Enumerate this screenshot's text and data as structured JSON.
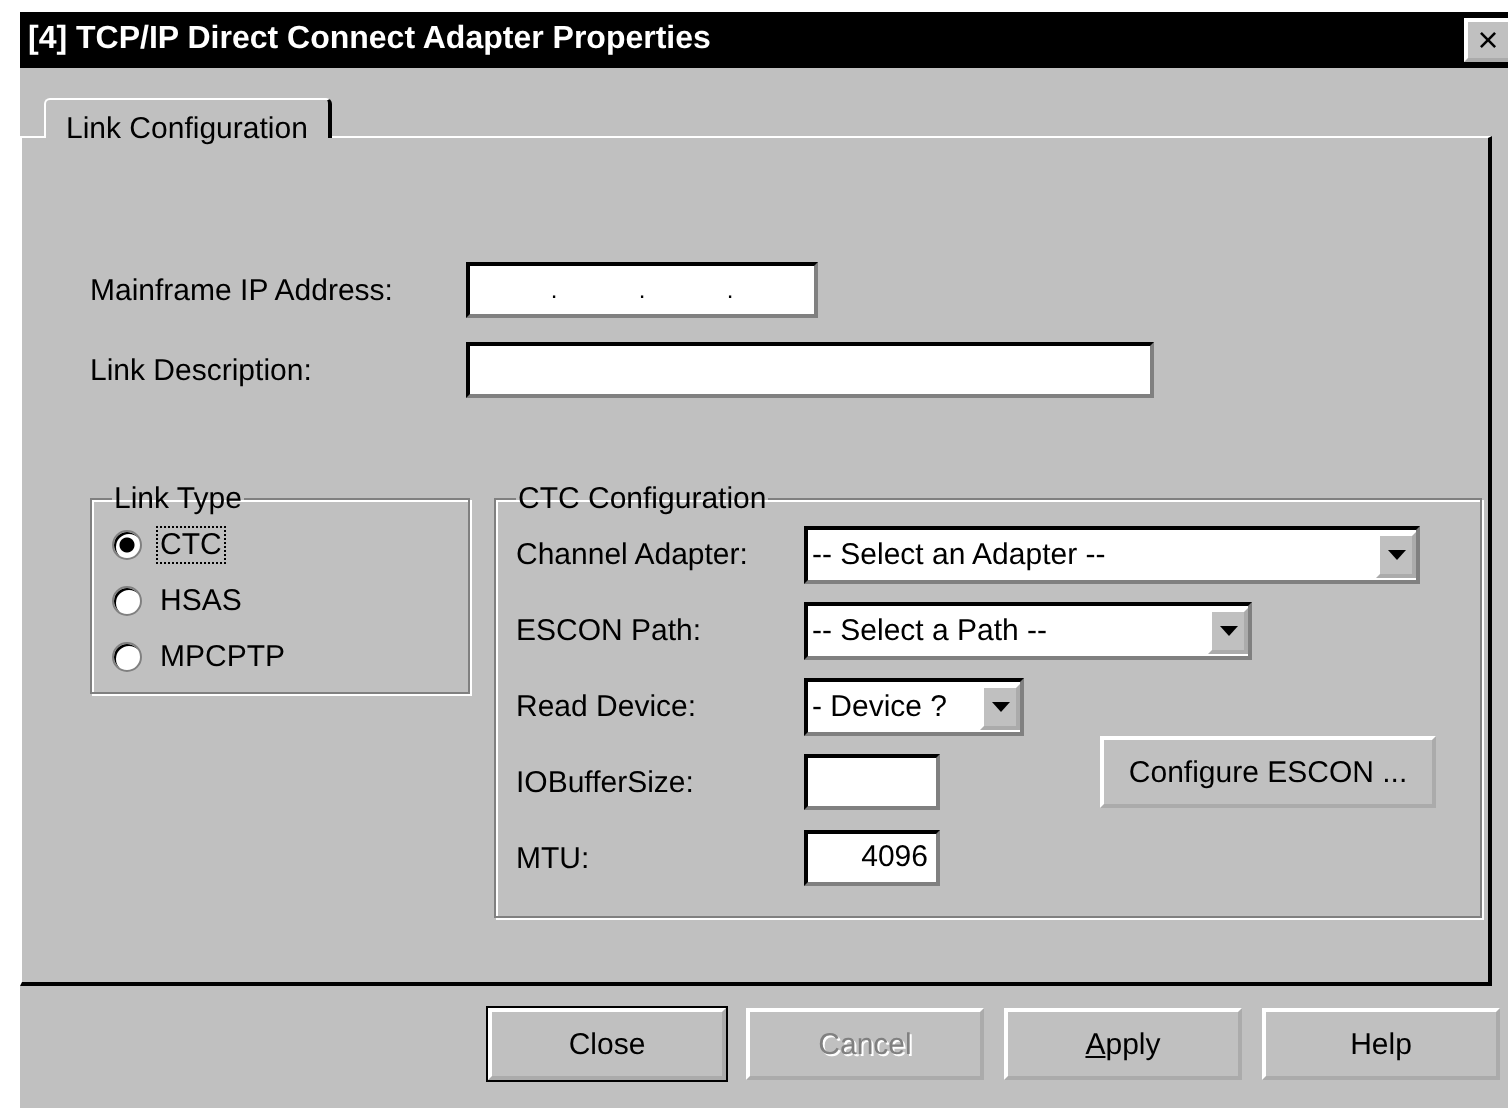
{
  "window": {
    "title": "[4] TCP/IP Direct Connect Adapter Properties",
    "close": "×"
  },
  "tabs": [
    {
      "label": "Link Configuration",
      "selected": true
    }
  ],
  "ip_field": {
    "label": "Mainframe IP Address:",
    "separators": [
      ".",
      ".",
      "."
    ]
  },
  "description_field": {
    "label": "Link Description:"
  },
  "link_type": {
    "title": "Link Type",
    "options": [
      {
        "label": "CTC",
        "selected": true,
        "focused": true
      },
      {
        "label": "HSAS",
        "selected": false,
        "focused": false
      },
      {
        "label": "MPCPTP",
        "selected": false,
        "focused": false
      }
    ]
  },
  "ctc": {
    "title": "CTC Configuration",
    "rows": [
      {
        "kind": "combo",
        "label": "Channel Adapter:",
        "value": "-- Select an Adapter --"
      },
      {
        "kind": "combo",
        "label": "ESCON Path:",
        "value": "-- Select a Path --"
      },
      {
        "kind": "combo",
        "label": "Read Device:",
        "value": "- Device ?"
      },
      {
        "kind": "field",
        "label": "IOBufferSize:"
      },
      {
        "kind": "field",
        "label": "MTU:",
        "value": "4096"
      }
    ],
    "configure_button": "Configure ESCON ..."
  },
  "buttons": [
    {
      "label": "Close",
      "disabled": false,
      "default": true,
      "underline_first": false
    },
    {
      "label": "Cancel",
      "disabled": true,
      "default": false,
      "underline_first": false
    },
    {
      "label": "Apply",
      "disabled": false,
      "default": false,
      "underline_first": true
    },
    {
      "label": "Help",
      "disabled": false,
      "default": false,
      "underline_first": false
    }
  ]
}
